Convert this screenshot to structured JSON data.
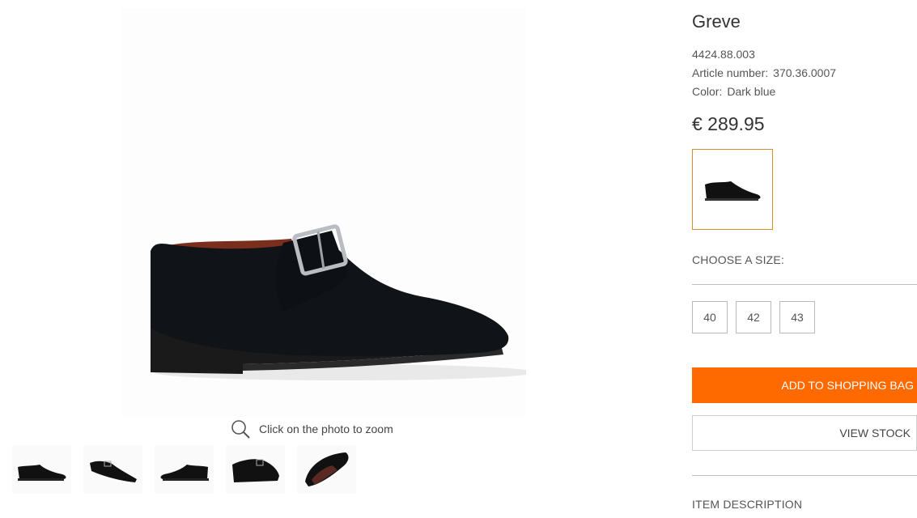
{
  "product": {
    "name": "Greve",
    "code": "4424.88.003",
    "article_label": "Article number:",
    "article_number": "370.36.0007",
    "color_label": "Color:",
    "color_value": "Dark blue",
    "price": "€ 289.95"
  },
  "gallery": {
    "zoom_hint": "Click on the photo to zoom",
    "thumbnails": [
      {
        "view": "side"
      },
      {
        "view": "three-quarter"
      },
      {
        "view": "side-inner"
      },
      {
        "view": "front-quarter"
      },
      {
        "view": "sole"
      }
    ]
  },
  "sizes": {
    "label": "CHOOSE A SIZE:",
    "options": [
      "40",
      "42",
      "43"
    ]
  },
  "actions": {
    "add_to_bag": "ADD TO SHOPPING BAG",
    "view_stock": "VIEW STOCK"
  },
  "sections": {
    "item_description": "ITEM DESCRIPTION"
  },
  "colors": {
    "accent": "#ff6a00",
    "swatch_border": "#d98b2b",
    "shoe": "#101318",
    "lining": "#7a2e1c"
  }
}
